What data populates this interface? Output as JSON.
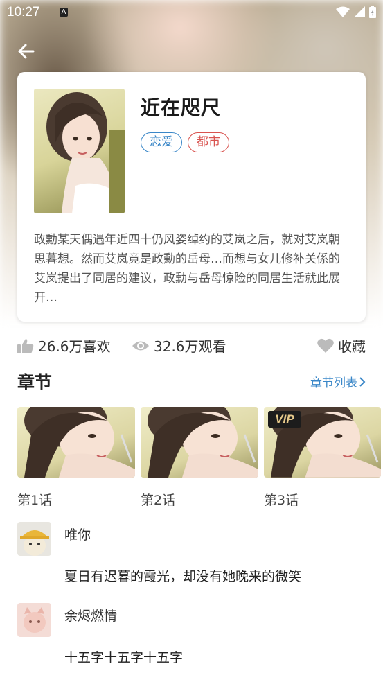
{
  "status_bar": {
    "time": "10:27",
    "notification_letter": "A"
  },
  "comic": {
    "title": "近在咫尺",
    "tags": [
      "恋爱",
      "都市"
    ],
    "description": "政勳某天偶遇年近四十仍风姿绰约的艾岚之后，就对艾岚朝思暮想。然而艾岚竟是政勳的岳母…而想与女儿修补关係的艾岚提出了同居的建议，政勳与岳母惊险的同居生活就此展开…"
  },
  "stats": {
    "likes": "26.6万喜欢",
    "views": "32.6万观看",
    "favorite": "收藏"
  },
  "chapters": {
    "title": "章节",
    "list_link": "章节列表",
    "items": [
      {
        "label": "第1话"
      },
      {
        "label": "第2话"
      },
      {
        "label": "第3话",
        "badge": "VIP"
      }
    ]
  },
  "comments": [
    {
      "user": "唯你",
      "text": "夏日有迟暮的霞光，却没有她晚来的微笑"
    },
    {
      "user": "余烬燃情",
      "text": "十五字十五字十五字"
    }
  ],
  "colors": {
    "accent_blue": "#3a87c8",
    "tag_red": "#d9534f"
  }
}
